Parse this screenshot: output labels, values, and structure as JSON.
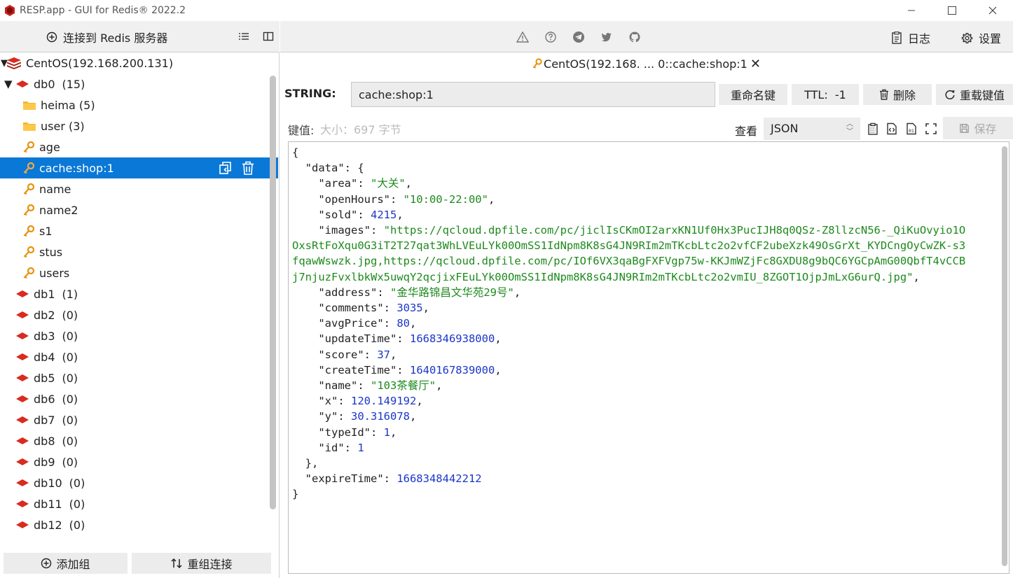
{
  "window": {
    "title": "RESP.app - GUI for Redis® 2022.2",
    "minimize_label": "—",
    "maximize_label": "☐",
    "close_label": "✕"
  },
  "sidebar": {
    "connect_label": "连接到 Redis 服务器",
    "connection": "CentOS(192.168.200.131)",
    "db0": {
      "label": "db0",
      "count": "(15)"
    },
    "db0_items": [
      {
        "label": "heima (5)",
        "kind": "folder"
      },
      {
        "label": "user (3)",
        "kind": "folder"
      },
      {
        "label": "age",
        "kind": "key"
      },
      {
        "label": "cache:shop:1",
        "kind": "key",
        "selected": true
      },
      {
        "label": "name",
        "kind": "key"
      },
      {
        "label": "name2",
        "kind": "key"
      },
      {
        "label": "s1",
        "kind": "key"
      },
      {
        "label": "stus",
        "kind": "key"
      },
      {
        "label": "users",
        "kind": "key"
      }
    ],
    "dbs": [
      {
        "label": "db1",
        "count": "(1)"
      },
      {
        "label": "db2",
        "count": "(0)"
      },
      {
        "label": "db3",
        "count": "(0)"
      },
      {
        "label": "db4",
        "count": "(0)"
      },
      {
        "label": "db5",
        "count": "(0)"
      },
      {
        "label": "db6",
        "count": "(0)"
      },
      {
        "label": "db7",
        "count": "(0)"
      },
      {
        "label": "db8",
        "count": "(0)"
      },
      {
        "label": "db9",
        "count": "(0)"
      },
      {
        "label": "db10",
        "count": "(0)"
      },
      {
        "label": "db11",
        "count": "(0)"
      },
      {
        "label": "db12",
        "count": "(0)"
      }
    ],
    "add_group_label": "添加组",
    "regroup_label": "重组连接"
  },
  "toolbar": {
    "log_label": "日志",
    "settings_label": "设置"
  },
  "tab": {
    "label": "CentOS(192.168. ... 0::cache:shop:1",
    "close": "✕"
  },
  "key": {
    "type": "STRING:",
    "name": "cache:shop:1",
    "rename_label": "重命名键",
    "ttl_label": "TTL:  -1",
    "delete_label": "删除",
    "reload_label": "重载键值"
  },
  "value": {
    "label": "键值:",
    "size_label": "大小：697 字节",
    "view_label": "查看",
    "format": "JSON",
    "save_label": "保存"
  },
  "json_lines": [
    [
      [
        "k",
        "{"
      ]
    ],
    [
      [
        "k",
        "  \"data\": {"
      ]
    ],
    [
      [
        "k",
        "    \"area\": "
      ],
      [
        "s",
        "\"大关\""
      ],
      [
        "k",
        ","
      ]
    ],
    [
      [
        "k",
        "    \"openHours\": "
      ],
      [
        "s",
        "\"10:00-22:00\""
      ],
      [
        "k",
        ","
      ]
    ],
    [
      [
        "k",
        "    \"sold\": "
      ],
      [
        "n",
        "4215"
      ],
      [
        "k",
        ","
      ]
    ],
    [
      [
        "k",
        "    \"images\": "
      ],
      [
        "s",
        "\"https://qcloud.dpfile.com/pc/jiclIsCKmOI2arxKN1Uf0Hx3PucIJH8q0QSz-Z8llzcN56-_QiKuOvyio1O"
      ]
    ],
    [
      [
        "s",
        "OxsRtFoXqu0G3iT2T27qat3WhLVEuLYk00OmSS1IdNpm8K8sG4JN9RIm2mTKcbLtc2o2vfCF2ubeXzk49OsGrXt_KYDCngOyCwZK-s3"
      ]
    ],
    [
      [
        "s",
        "fqawWswzk.jpg,https://qcloud.dpfile.com/pc/IOf6VX3qaBgFXFVgp75w-KKJmWZjFc8GXDU8g9bQC6YGCpAmG00QbfT4vCCB"
      ]
    ],
    [
      [
        "s",
        "j7njuzFvxlbkWx5uwqY2qcjixFEuLYk00OmSS1IdNpm8K8sG4JN9RIm2mTKcbLtc2o2vmIU_8ZGOT1OjpJmLxG6urQ.jpg\""
      ],
      [
        "k",
        ","
      ]
    ],
    [
      [
        "k",
        "    \"address\": "
      ],
      [
        "s",
        "\"金华路锦昌文华苑29号\""
      ],
      [
        "k",
        ","
      ]
    ],
    [
      [
        "k",
        "    \"comments\": "
      ],
      [
        "n",
        "3035"
      ],
      [
        "k",
        ","
      ]
    ],
    [
      [
        "k",
        "    \"avgPrice\": "
      ],
      [
        "n",
        "80"
      ],
      [
        "k",
        ","
      ]
    ],
    [
      [
        "k",
        "    \"updateTime\": "
      ],
      [
        "n",
        "1668346938000"
      ],
      [
        "k",
        ","
      ]
    ],
    [
      [
        "k",
        "    \"score\": "
      ],
      [
        "n",
        "37"
      ],
      [
        "k",
        ","
      ]
    ],
    [
      [
        "k",
        "    \"createTime\": "
      ],
      [
        "n",
        "1640167839000"
      ],
      [
        "k",
        ","
      ]
    ],
    [
      [
        "k",
        "    \"name\": "
      ],
      [
        "s",
        "\"103茶餐厅\""
      ],
      [
        "k",
        ","
      ]
    ],
    [
      [
        "k",
        "    \"x\": "
      ],
      [
        "n",
        "120.149192"
      ],
      [
        "k",
        ","
      ]
    ],
    [
      [
        "k",
        "    \"y\": "
      ],
      [
        "n",
        "30.316078"
      ],
      [
        "k",
        ","
      ]
    ],
    [
      [
        "k",
        "    \"typeId\": "
      ],
      [
        "n",
        "1"
      ],
      [
        "k",
        ","
      ]
    ],
    [
      [
        "k",
        "    \"id\": "
      ],
      [
        "n",
        "1"
      ]
    ],
    [
      [
        "k",
        "  },"
      ]
    ],
    [
      [
        "k",
        "  \"expireTime\": "
      ],
      [
        "n",
        "1668348442212"
      ]
    ],
    [
      [
        "k",
        "}"
      ]
    ]
  ],
  "colors": {
    "accent": "#0a78d7",
    "string": "#1e8a1e",
    "number": "#1b36c8",
    "redis_red": "#d82c20",
    "folder": "#f5b731",
    "key_icon": "#e8910c"
  },
  "icons": [
    "redis-logo-icon",
    "plus-circle-icon",
    "list-icon",
    "panel-icon",
    "warning-icon",
    "help-icon",
    "telegram-icon",
    "twitter-icon",
    "github-icon",
    "log-icon",
    "gear-icon",
    "folder-icon",
    "key-icon",
    "db-icon",
    "copy-icon",
    "trash-icon",
    "reload-icon",
    "save-icon"
  ]
}
